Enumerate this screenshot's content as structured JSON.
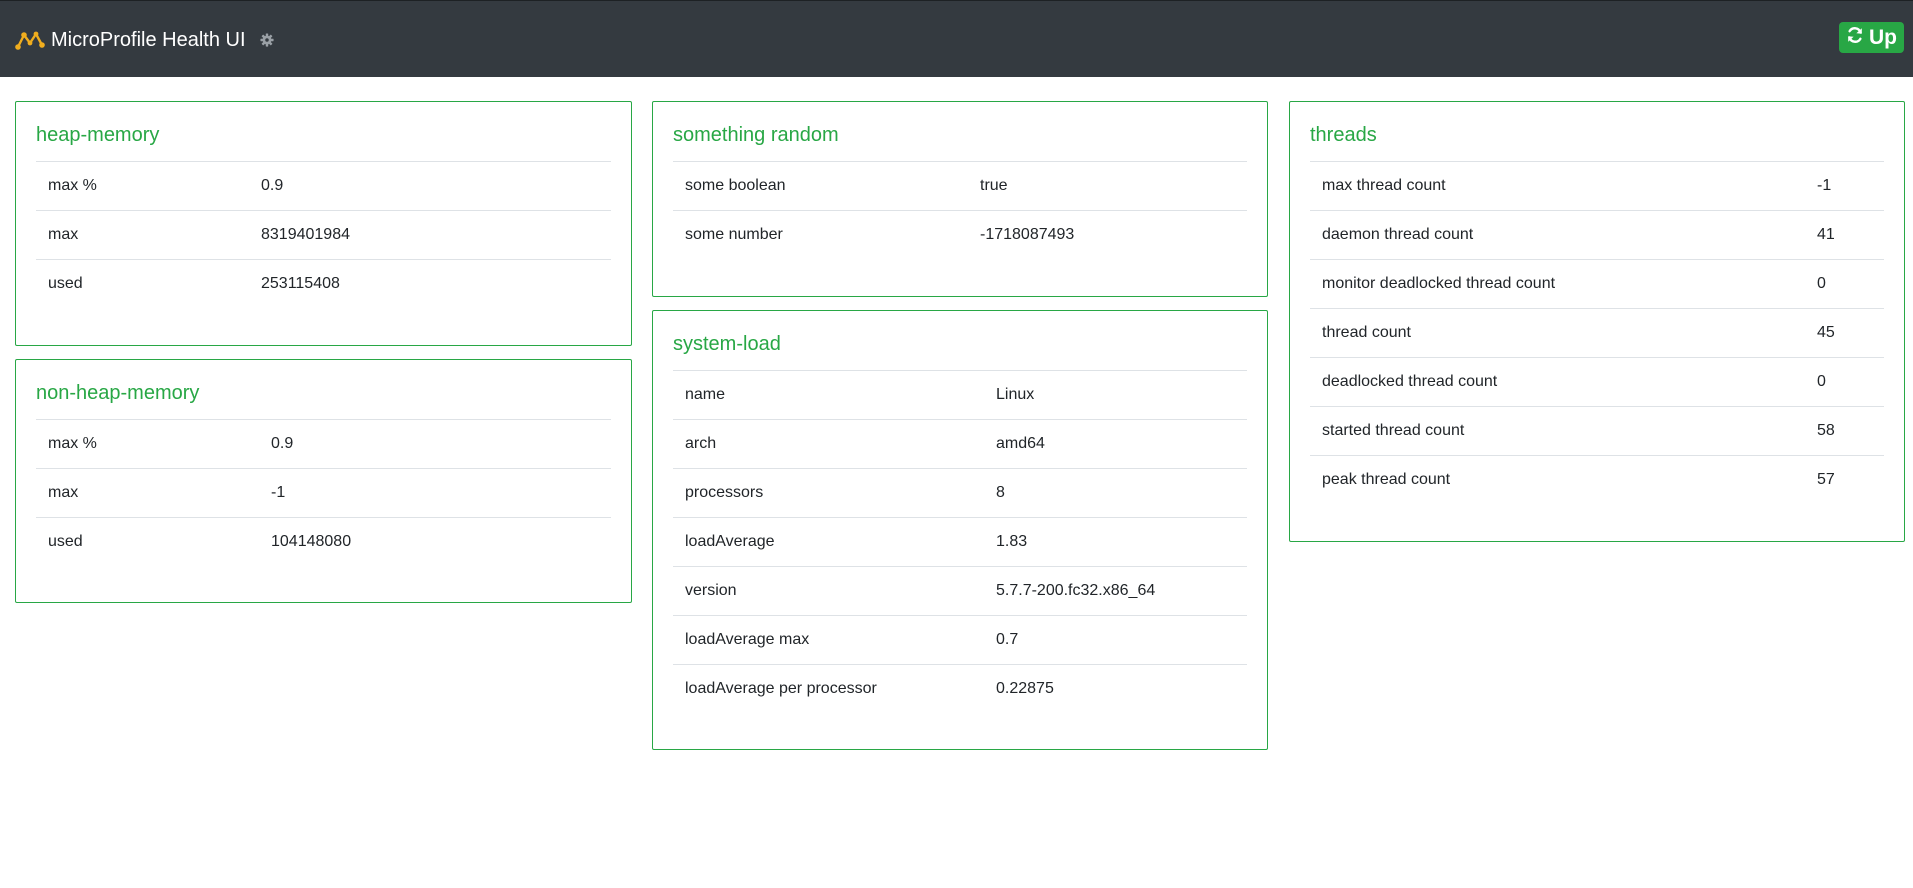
{
  "header": {
    "title": "MicroProfile Health UI",
    "status_label": "Up",
    "status_color": "#28a745",
    "logo_icon": "microprofile-logo-icon",
    "settings_icon": "gear-icon",
    "status_icon": "refresh-icon"
  },
  "cards": {
    "heap": {
      "title": "heap-memory",
      "rows": [
        {
          "key": "max %",
          "value": "0.9"
        },
        {
          "key": "max",
          "value": "8319401984"
        },
        {
          "key": "used",
          "value": "253115408"
        }
      ]
    },
    "nonheap": {
      "title": "non-heap-memory",
      "rows": [
        {
          "key": "max %",
          "value": "0.9"
        },
        {
          "key": "max",
          "value": "-1"
        },
        {
          "key": "used",
          "value": "104148080"
        }
      ]
    },
    "random": {
      "title": "something random",
      "rows": [
        {
          "key": "some boolean",
          "value": "true"
        },
        {
          "key": "some number",
          "value": "-1718087493"
        }
      ]
    },
    "sysload": {
      "title": "system-load",
      "rows": [
        {
          "key": "name",
          "value": "Linux"
        },
        {
          "key": "arch",
          "value": "amd64"
        },
        {
          "key": "processors",
          "value": "8"
        },
        {
          "key": "loadAverage",
          "value": "1.83"
        },
        {
          "key": "version",
          "value": "5.7.7-200.fc32.x86_64"
        },
        {
          "key": "loadAverage max",
          "value": "0.7"
        },
        {
          "key": "loadAverage per processor",
          "value": "0.22875"
        }
      ]
    },
    "threads": {
      "title": "threads",
      "rows": [
        {
          "key": "max thread count",
          "value": "-1"
        },
        {
          "key": "daemon thread count",
          "value": "41"
        },
        {
          "key": "monitor deadlocked thread count",
          "value": "0"
        },
        {
          "key": "thread count",
          "value": "45"
        },
        {
          "key": "deadlocked thread count",
          "value": "0"
        },
        {
          "key": "started thread count",
          "value": "58"
        },
        {
          "key": "peak thread count",
          "value": "57"
        }
      ]
    }
  }
}
